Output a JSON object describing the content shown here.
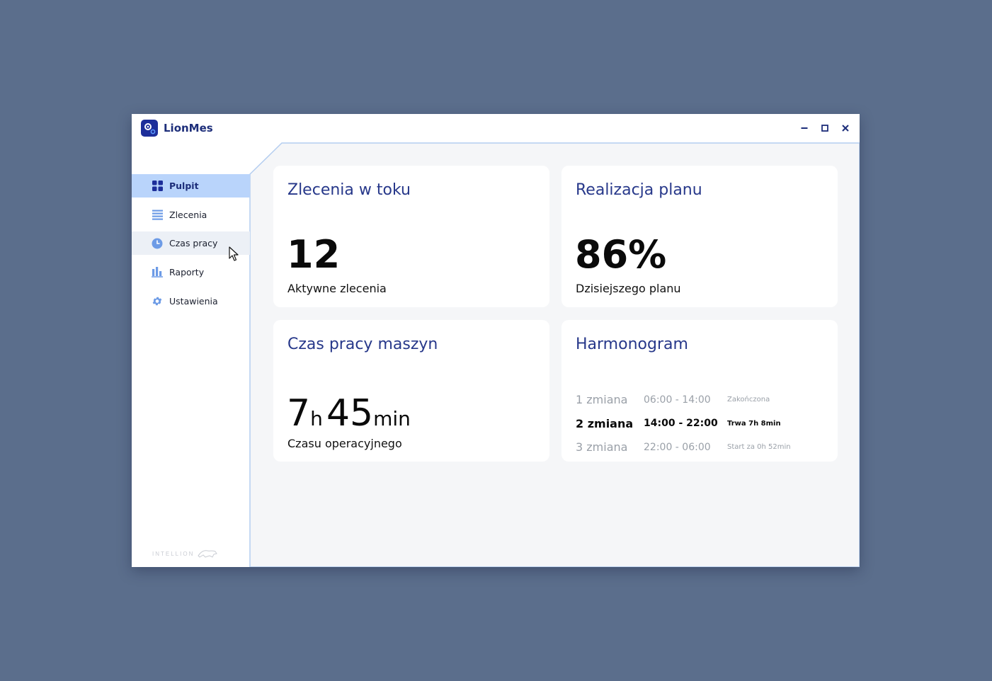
{
  "app": {
    "title": "LionMes"
  },
  "colors": {
    "desktop": "#5b6e8c",
    "accent": "#27388a",
    "active_nav": "#b9d4fb",
    "panel_bg": "#f5f6f8"
  },
  "sidebar": {
    "items": [
      {
        "label": "Pulpit",
        "icon": "grid-icon"
      },
      {
        "label": "Zlecenia",
        "icon": "list-icon"
      },
      {
        "label": "Czas pracy",
        "icon": "clock-icon"
      },
      {
        "label": "Raporty",
        "icon": "bar-chart-icon"
      },
      {
        "label": "Ustawienia",
        "icon": "gear-icon"
      }
    ],
    "active": "Pulpit",
    "hovered": "Czas pracy",
    "brand": "INTELLION"
  },
  "cards": {
    "orders": {
      "title": "Zlecenia w toku",
      "value": "12",
      "subtitle": "Aktywne zlecenia"
    },
    "plan": {
      "title": "Realizacja planu",
      "value": "86%",
      "subtitle": "Dzisiejszego planu"
    },
    "machine_time": {
      "title": "Czas pracy maszyn",
      "hours": "7",
      "hours_unit": "h",
      "minutes": "45",
      "minutes_unit": "min",
      "subtitle": "Czasu operacyjnego"
    },
    "schedule": {
      "title": "Harmonogram",
      "shifts": [
        {
          "name": "1 zmiana",
          "hours": "06:00 - 14:00",
          "status": "Zakończona"
        },
        {
          "name": "2 zmiana",
          "hours": "14:00 - 22:00",
          "status": "Trwa 7h 8min"
        },
        {
          "name": "3 zmiana",
          "hours": "22:00 - 06:00",
          "status": "Start za 0h 52min"
        }
      ]
    }
  }
}
